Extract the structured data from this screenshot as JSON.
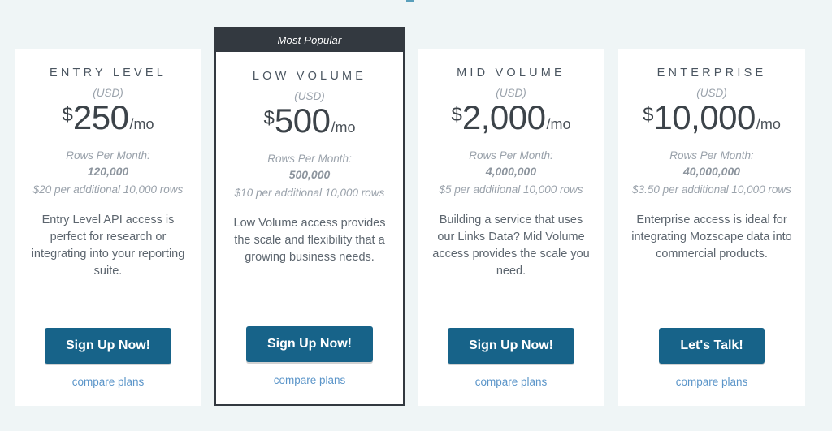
{
  "page": {
    "background_color": "#eff5f6",
    "accent_button_color": "#176389",
    "link_color": "#5b95c9",
    "featured_banner_color": "#333940"
  },
  "plans": [
    {
      "name": "ENTRY LEVEL",
      "featured": false,
      "badge": "",
      "currency_note": "(USD)",
      "price_sign": "$",
      "price_amount": "250",
      "price_period": "/mo",
      "rows_label": "Rows Per Month:",
      "rows_value": "120,000",
      "overage": "$20 per additional 10,000 rows",
      "description": "Entry Level API access is perfect for research or integrating into your reporting suite.",
      "cta_label": "Sign Up Now!",
      "compare_label": "compare plans"
    },
    {
      "name": "LOW VOLUME",
      "featured": true,
      "badge": "Most Popular",
      "currency_note": "(USD)",
      "price_sign": "$",
      "price_amount": "500",
      "price_period": "/mo",
      "rows_label": "Rows Per Month:",
      "rows_value": "500,000",
      "overage": "$10 per additional 10,000 rows",
      "description": "Low Volume access provides the scale and flexibility that a growing business needs.",
      "cta_label": "Sign Up Now!",
      "compare_label": "compare plans"
    },
    {
      "name": "MID VOLUME",
      "featured": false,
      "badge": "",
      "currency_note": "(USD)",
      "price_sign": "$",
      "price_amount": "2,000",
      "price_period": "/mo",
      "rows_label": "Rows Per Month:",
      "rows_value": "4,000,000",
      "overage": "$5 per additional 10,000 rows",
      "description": "Building a service that uses our Links Data? Mid Volume access provides the scale you need.",
      "cta_label": "Sign Up Now!",
      "compare_label": "compare plans"
    },
    {
      "name": "ENTERPRISE",
      "featured": false,
      "badge": "",
      "currency_note": "(USD)",
      "price_sign": "$",
      "price_amount": "10,000",
      "price_period": "/mo",
      "rows_label": "Rows Per Month:",
      "rows_value": "40,000,000",
      "overage": "$3.50 per additional 10,000 rows",
      "description": "Enterprise access is ideal for integrating Mozscape data into commercial products.",
      "cta_label": "Let's Talk!",
      "compare_label": "compare plans"
    }
  ]
}
